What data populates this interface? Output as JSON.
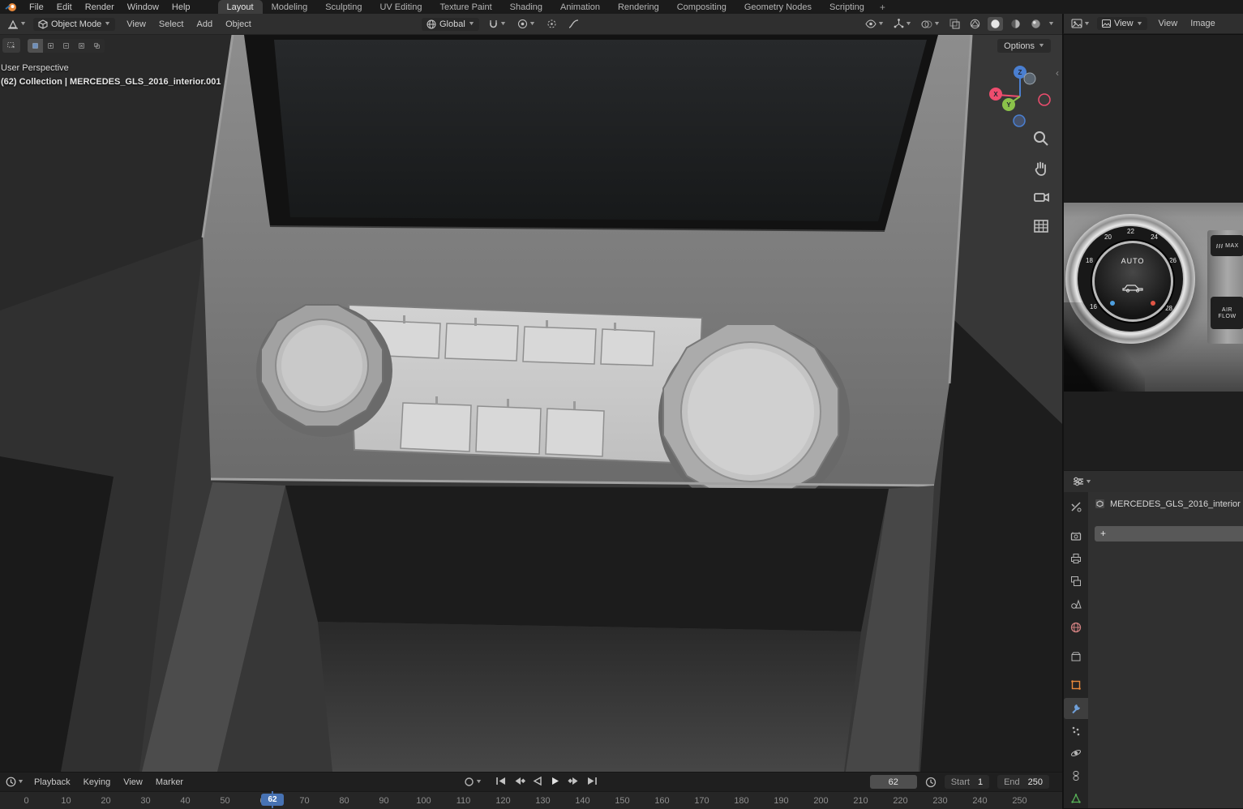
{
  "topbar": {
    "menus": [
      {
        "label": "File"
      },
      {
        "label": "Edit"
      },
      {
        "label": "Render"
      },
      {
        "label": "Window"
      },
      {
        "label": "Help"
      }
    ],
    "workspaces": [
      {
        "label": "Layout",
        "active": true
      },
      {
        "label": "Modeling"
      },
      {
        "label": "Sculpting"
      },
      {
        "label": "UV Editing"
      },
      {
        "label": "Texture Paint"
      },
      {
        "label": "Shading"
      },
      {
        "label": "Animation"
      },
      {
        "label": "Rendering"
      },
      {
        "label": "Compositing"
      },
      {
        "label": "Geometry Nodes"
      },
      {
        "label": "Scripting"
      }
    ],
    "add_workspace": "+"
  },
  "viewport": {
    "header": {
      "mode_label": "Object Mode",
      "menus": [
        {
          "label": "View"
        },
        {
          "label": "Select"
        },
        {
          "label": "Add"
        },
        {
          "label": "Object"
        }
      ],
      "orientation": "Global",
      "icon_names": [
        "editor-type-3d-viewport",
        "object-mode-cube",
        "snap-magnet",
        "proportional-editing",
        "pivot-point",
        "falloff",
        "visibility-eye",
        "gizmo-toggle",
        "overlays-toggle",
        "xray-toggle",
        "shading-wireframe",
        "shading-solid",
        "shading-material",
        "shading-rendered"
      ]
    },
    "options_button": "Options",
    "overlay": {
      "line1": "User Perspective",
      "line2": "(62) Collection | MERCEDES_GLS_2016_interior.001"
    },
    "gizmo": {
      "x": "X",
      "y": "Y",
      "z": "Z"
    },
    "nav_icons": [
      "zoom",
      "pan-hand",
      "camera-view",
      "orthographic-grid"
    ],
    "tool_icons": [
      "select-box-tool",
      "select-set",
      "select-extend",
      "select-subtract",
      "select-invert",
      "select-intersect"
    ]
  },
  "image_editor": {
    "mode": "View",
    "menus": [
      {
        "label": "View"
      },
      {
        "label": "Image"
      }
    ],
    "photo": {
      "dial": {
        "n16": "16",
        "n18": "18",
        "n20": "20",
        "n22": "22",
        "n24": "24",
        "n26": "26",
        "n28": "28"
      },
      "auto": "AUTO",
      "max": "MAX",
      "air_line1": "AIR",
      "air_line2": "FLOW"
    }
  },
  "properties": {
    "object_name": "MERCEDES_GLS_2016_interior",
    "add_modifier": "+",
    "tabs": [
      "tool",
      "render",
      "output",
      "view-layer",
      "scene",
      "world",
      "collection",
      "object",
      "modifiers",
      "particles",
      "physics",
      "constraints",
      "object-data"
    ],
    "active_tab": "modifiers"
  },
  "timeline": {
    "menus": [
      {
        "label": "Playback"
      },
      {
        "label": "Keying"
      },
      {
        "label": "View"
      },
      {
        "label": "Marker"
      }
    ],
    "transport": [
      "jump-to-start",
      "previous-keyframe",
      "play-reverse",
      "play",
      "next-keyframe",
      "jump-to-end"
    ],
    "current_frame": "62",
    "start_label": "Start",
    "start_value": "1",
    "end_label": "End",
    "end_value": "250",
    "playhead_frame": "62",
    "ruler": [
      "0",
      "10",
      "20",
      "30",
      "40",
      "50",
      "60",
      "70",
      "80",
      "90",
      "100",
      "110",
      "120",
      "130",
      "140",
      "150",
      "160",
      "170",
      "180",
      "190",
      "200",
      "210",
      "220",
      "230",
      "240",
      "250"
    ]
  },
  "colors": {
    "accent": "#4772b3",
    "axis_x": "#ee4d6e",
    "axis_y": "#8bc24a",
    "axis_z": "#4a7fd1",
    "object_orange": "#e8883a",
    "world_red": "#dderror",
    "data_green": "#46a04b"
  }
}
